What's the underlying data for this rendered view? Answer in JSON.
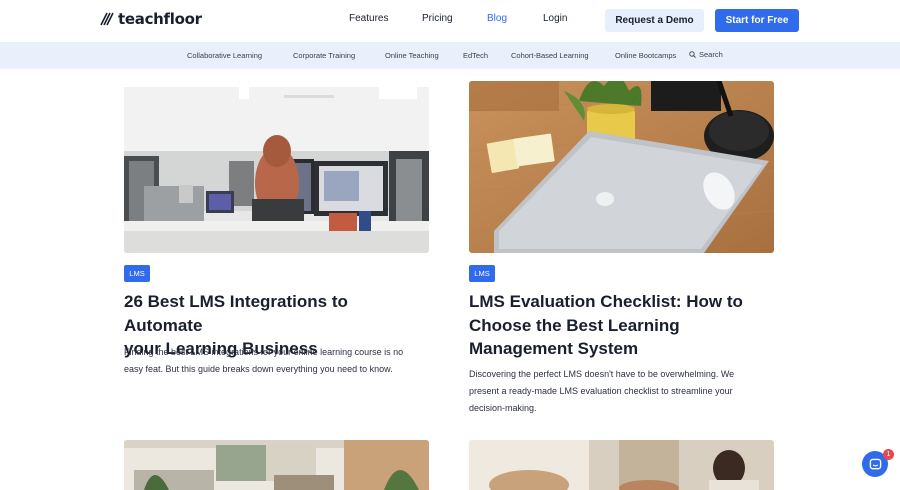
{
  "brand": {
    "name": "teachfloor"
  },
  "nav": {
    "features": "Features",
    "pricing": "Pricing",
    "blog": "Blog",
    "login": "Login",
    "request_demo": "Request a Demo",
    "start_free": "Start for Free"
  },
  "subnav": {
    "items": [
      "Collaborative Learning",
      "Corporate Training",
      "Online Teaching",
      "EdTech",
      "Cohort-Based Learning",
      "Online Bootcamps"
    ],
    "search": "Search"
  },
  "cards": [
    {
      "tag": "LMS",
      "title_line1": "26 Best LMS Integrations to Automate",
      "title_line2": "your Learning Business",
      "desc_line1": "Finding the best LMS integrations for your online learning course is no",
      "desc_line2": "easy feat. But this guide breaks down everything you need to know."
    },
    {
      "tag": "LMS",
      "title_line1": "LMS Evaluation Checklist: How to",
      "title_line2": "Choose the Best Learning",
      "title_line3": "Management System",
      "desc_line1": "Discovering the perfect LMS doesn't have to be overwhelming. We",
      "desc_line2": "present a ready-made LMS evaluation checklist to streamline your",
      "desc_line3": "decision-making."
    }
  ],
  "chat": {
    "badge": "1"
  },
  "colors": {
    "accent": "#2f6bea",
    "subnav_bg": "#e9f0fb",
    "demo_bg": "#e7effd"
  }
}
